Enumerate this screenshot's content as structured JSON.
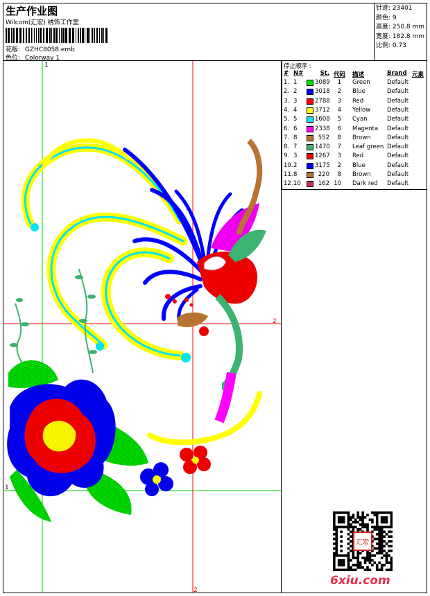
{
  "header": {
    "title": "生产作业图",
    "subtitle": "Wilcom(汇宏) 绣饰工作室",
    "pattern_label": "花版:",
    "pattern_value": "GZHC8058.emb",
    "colorway_label": "色位:",
    "colorway_value": "Colorway 1"
  },
  "info": {
    "stitches": "针迹: 23401",
    "colors": "颜色: 9",
    "height": "高度: 250.8 mm",
    "width": "宽度: 182.8 mm",
    "scale": "比例: 0.73"
  },
  "sequence": {
    "title": "停止顺序 :",
    "headers": {
      "num": "#",
      "no": "N#",
      "st": "St.",
      "code": "代码",
      "desc": "描述",
      "brand": "Brand",
      "elem": "元素"
    },
    "rows": [
      {
        "num": "1.",
        "no": "1",
        "color": "#00e000",
        "st": "3089",
        "code": "1",
        "desc": "Green",
        "brand": "Default"
      },
      {
        "num": "2.",
        "no": "2",
        "color": "#0000ff",
        "st": "3018",
        "code": "2",
        "desc": "Blue",
        "brand": "Default"
      },
      {
        "num": "3.",
        "no": "3",
        "color": "#ff0000",
        "st": "2788",
        "code": "3",
        "desc": "Red",
        "brand": "Default"
      },
      {
        "num": "4.",
        "no": "4",
        "color": "#ffff00",
        "st": "3712",
        "code": "4",
        "desc": "Yellow",
        "brand": "Default"
      },
      {
        "num": "5.",
        "no": "5",
        "color": "#00e5f0",
        "st": "1608",
        "code": "5",
        "desc": "Cyan",
        "brand": "Default"
      },
      {
        "num": "6.",
        "no": "6",
        "color": "#ff00ff",
        "st": "2338",
        "code": "6",
        "desc": "Magenta",
        "brand": "Default"
      },
      {
        "num": "7.",
        "no": "8",
        "color": "#b87333",
        "st": "552",
        "code": "8",
        "desc": "Brown",
        "brand": "Default"
      },
      {
        "num": "8.",
        "no": "7",
        "color": "#3cb371",
        "st": "1470",
        "code": "7",
        "desc": "Leaf green",
        "brand": "Default"
      },
      {
        "num": "9.",
        "no": "3",
        "color": "#ff0000",
        "st": "1267",
        "code": "3",
        "desc": "Red",
        "brand": "Default"
      },
      {
        "num": "10.",
        "no": "2",
        "color": "#0000ff",
        "st": "3175",
        "code": "2",
        "desc": "Blue",
        "brand": "Default"
      },
      {
        "num": "11.",
        "no": "8",
        "color": "#b87333",
        "st": "220",
        "code": "8",
        "desc": "Brown",
        "brand": "Default"
      },
      {
        "num": "12.",
        "no": "10",
        "color": "#c8325a",
        "st": "162",
        "code": "10",
        "desc": "Dark red",
        "brand": "Default"
      }
    ]
  },
  "design": {
    "guide_labels": {
      "top": "1",
      "right": "2",
      "left": "1",
      "bottom": "2"
    }
  },
  "watermark": "6xiu.com",
  "seal_text": "汇宏"
}
